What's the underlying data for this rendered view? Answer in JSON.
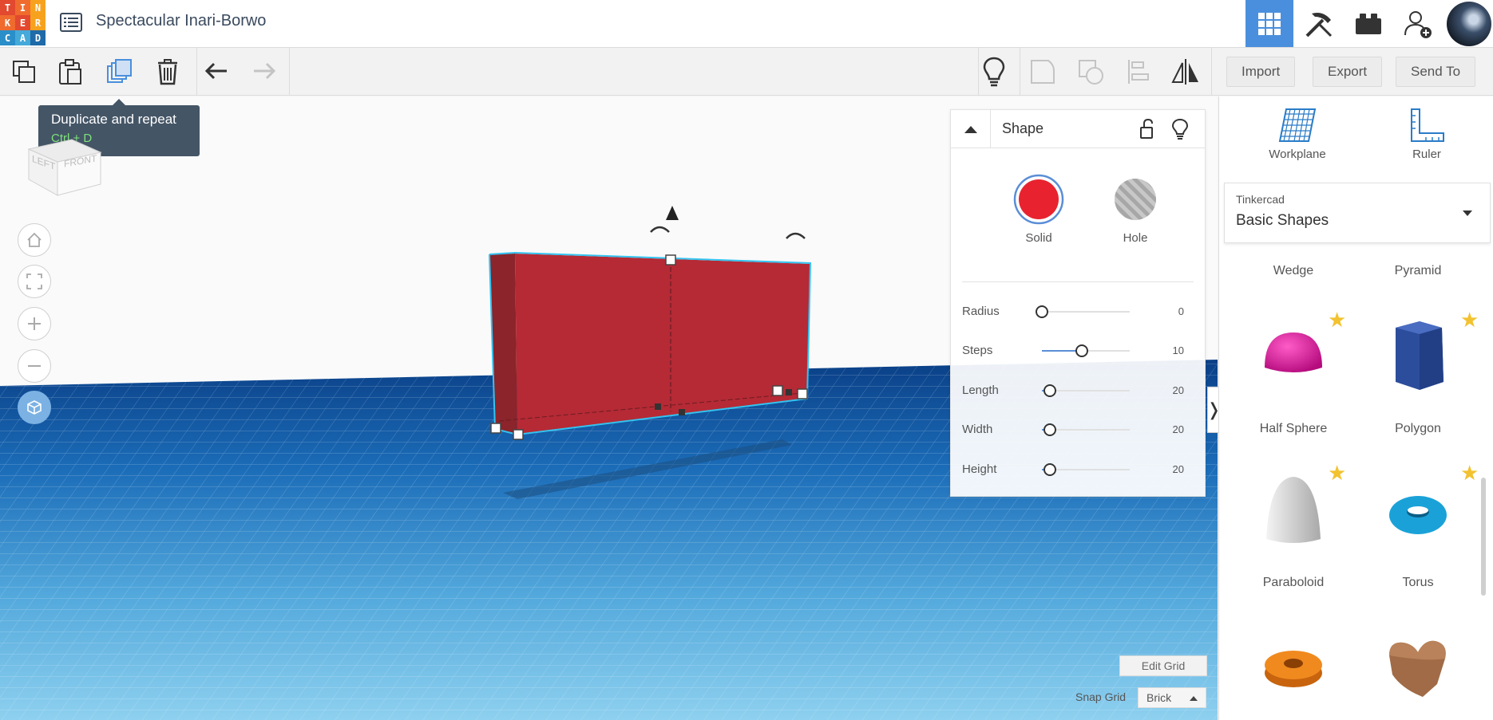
{
  "app": {
    "logo_letters": [
      "T",
      "I",
      "N",
      "K",
      "E",
      "R",
      "C",
      "A",
      "D"
    ],
    "logo_colors": [
      "#e2492f",
      "#f06b2e",
      "#f7a21e",
      "#f06b2e",
      "#e2492f",
      "#f7a21e",
      "#2a8ec9",
      "#45a9d9",
      "#1f6aa8"
    ],
    "project_title": "Spectacular Inari-Borwo"
  },
  "header": {
    "icons": [
      {
        "name": "3d-design-grid-icon",
        "active": true
      },
      {
        "name": "codeblocks-icon",
        "active": false
      },
      {
        "name": "bricks-icon",
        "active": false
      },
      {
        "name": "add-user-icon",
        "active": false
      }
    ],
    "active_color": "#4a8fdd"
  },
  "toolbar": {
    "left_tools": [
      "copy-icon",
      "paste-icon",
      "duplicate-icon",
      "trash-icon",
      "undo-icon",
      "redo-icon"
    ],
    "right_tools": [
      "lightbulb-icon",
      "group-icon",
      "ungroup-icon",
      "align-icon",
      "mirror-icon"
    ],
    "import_label": "Import",
    "export_label": "Export",
    "send_to_label": "Send To"
  },
  "tooltip": {
    "title": "Duplicate and repeat",
    "shortcut": "Ctrl + D"
  },
  "view_cube": {
    "left_label": "LEFT",
    "front_label": "FRONT"
  },
  "nav_buttons": [
    "home-icon",
    "fit-view-icon",
    "zoom-in-icon",
    "zoom-out-icon",
    "perspective-icon"
  ],
  "inspector": {
    "title": "Shape",
    "solid_label": "Solid",
    "hole_label": "Hole",
    "solid_color": "#e8232f",
    "properties": [
      {
        "name": "Radius",
        "value": "0",
        "fraction": 0.0
      },
      {
        "name": "Steps",
        "value": "10",
        "fraction": 0.45
      },
      {
        "name": "Length",
        "value": "20",
        "fraction": 0.09
      },
      {
        "name": "Width",
        "value": "20",
        "fraction": 0.09
      },
      {
        "name": "Height",
        "value": "20",
        "fraction": 0.09
      }
    ]
  },
  "grid_controls": {
    "edit_grid_label": "Edit Grid",
    "snap_grid_label": "Snap Grid",
    "snap_value": "Brick"
  },
  "library": {
    "workplane_label": "Workplane",
    "ruler_label": "Ruler",
    "category": "Tinkercad",
    "set": "Basic Shapes",
    "shapes": [
      {
        "name": "Wedge",
        "starred": false
      },
      {
        "name": "Pyramid",
        "starred": false
      },
      {
        "name": "Half Sphere",
        "starred": true
      },
      {
        "name": "Polygon",
        "starred": true
      },
      {
        "name": "Paraboloid",
        "starred": true
      },
      {
        "name": "Torus",
        "starred": true
      },
      {
        "name": "",
        "starred": false
      },
      {
        "name": "",
        "starred": false
      }
    ]
  },
  "panel_toggle_glyph": "❭"
}
